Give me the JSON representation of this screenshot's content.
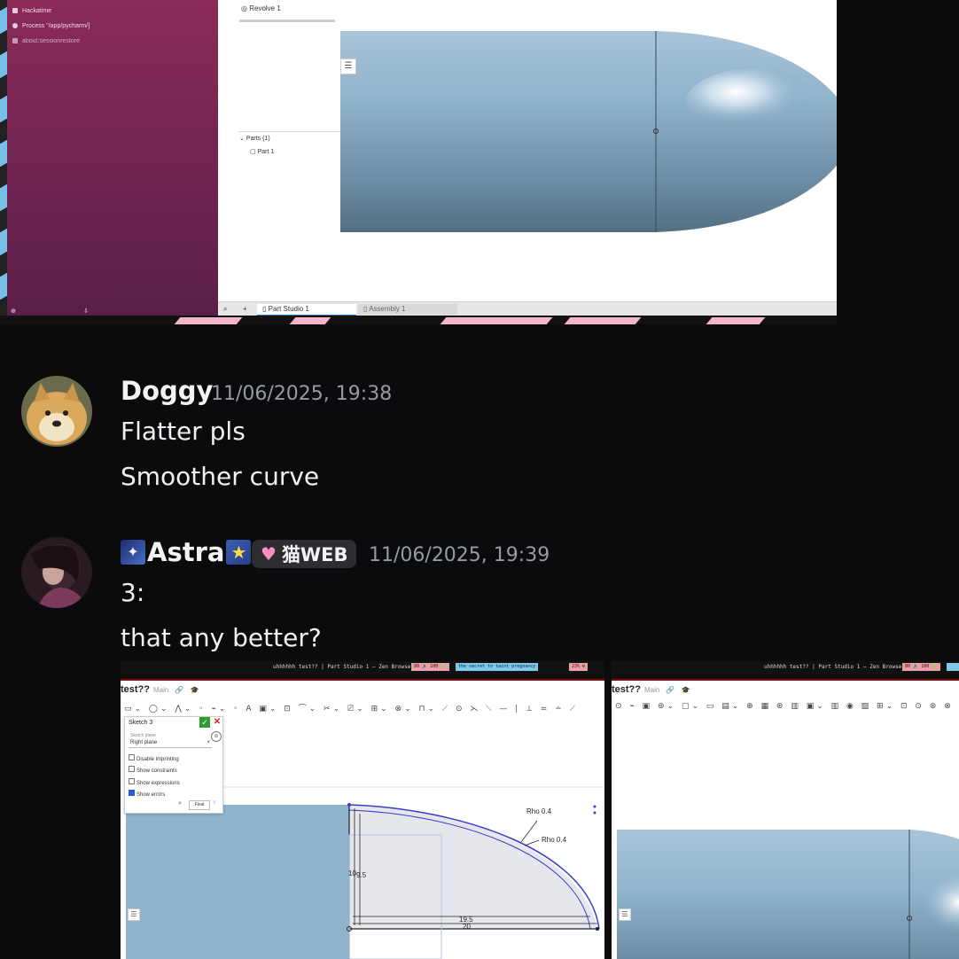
{
  "top_screenshot": {
    "browser_tabs": [
      "Hackatime",
      "Process \"/app/pycharm/]",
      "about:sessionrestore"
    ],
    "feature_item": "Revolve 1",
    "parts_header": "Parts (1)",
    "part_item": "Part 1",
    "tabs": [
      "Part Studio 1",
      "Assembly 1"
    ]
  },
  "messages": [
    {
      "author": "Doggy",
      "timestamp": "11/06/2025, 19:38",
      "lines": [
        "Flatter pls",
        "Smoother curve"
      ]
    },
    {
      "author": "Astra",
      "timestamp": "11/06/2025, 19:39",
      "badge": "猫WEB",
      "lines": [
        "3:",
        "that any better?"
      ]
    }
  ],
  "shot_left": {
    "window_title": "uhhhhhh test?? | Part Studio 1 — Zen Browser",
    "status_pill_1": "80 🔊 100 🔋",
    "status_pill_2": "the secret to taint pregnancy",
    "status_pill_3": "23% ⚙",
    "doc_title": "test??",
    "branch": "Main",
    "sketch_name": "Sketch 3",
    "sketch_plane_label": "Sketch plane",
    "sketch_plane_value": "Right plane",
    "options": [
      "Disable imprinting",
      "Show constraints",
      "Show expressions",
      "Show errors"
    ],
    "final_button": "Final",
    "dims": [
      "Rho 0.4",
      "Rho 0.4",
      "10",
      "9.5",
      "19.5",
      "20"
    ]
  },
  "shot_right": {
    "window_title": "uhhhhhh test?? | Part Studio 1 — Zen Browser",
    "status_pill_1": "80 🔊 100 🔋",
    "doc_title": "test??",
    "branch": "Main"
  },
  "colors": {
    "background": "#0b0b0d",
    "timestamp": "#949ba4",
    "model_blue": "#8fb3cc",
    "sketch_line": "#3a3fc9"
  }
}
